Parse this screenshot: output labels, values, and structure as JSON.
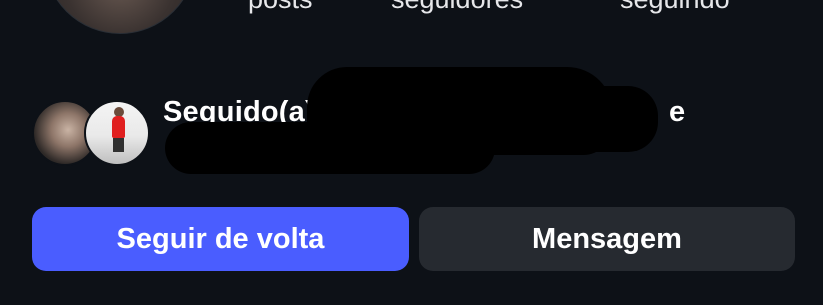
{
  "profile": {
    "stats": {
      "posts_label": "posts",
      "followers_label": "seguidores",
      "following_label": "seguindo"
    }
  },
  "followed_by": {
    "prefix": "Seguido(a) por",
    "conjunction": "e",
    "avatars": [
      "mutual-avatar-1",
      "mutual-avatar-2"
    ]
  },
  "actions": {
    "follow_back_label": "Seguir de volta",
    "message_label": "Mensagem"
  },
  "colors": {
    "background": "#0d1117",
    "follow_button": "#4a5dff",
    "message_button": "#262a30",
    "text": "#ffffff"
  }
}
